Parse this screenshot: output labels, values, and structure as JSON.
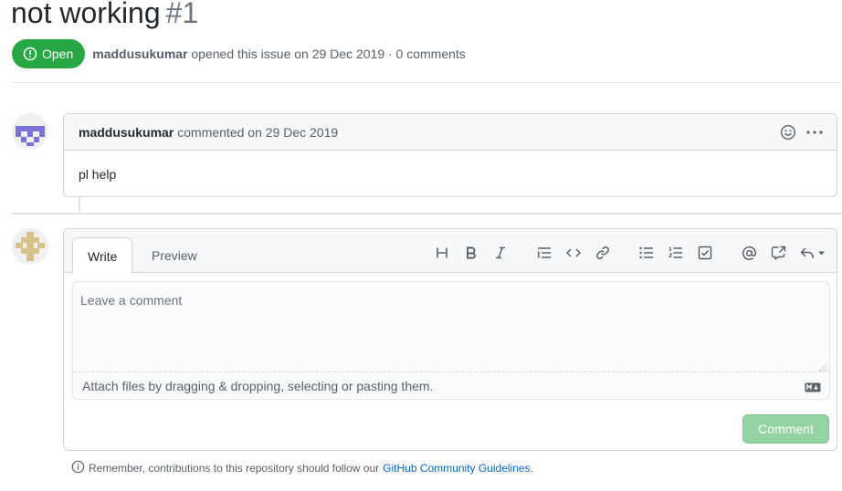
{
  "issue": {
    "title": "not working",
    "number": "#1",
    "state_label": "Open",
    "author": "maddusukumar",
    "meta_suffix": "opened this issue on 29 Dec 2019 · 0 comments"
  },
  "comment": {
    "author": "maddusukumar",
    "when": "commented on 29 Dec 2019",
    "body": "pl help"
  },
  "editor": {
    "tabs": [
      "Write",
      "Preview"
    ],
    "toolbar_icons": [
      "heading-icon",
      "bold-icon",
      "italic-icon",
      "quote-icon",
      "code-icon",
      "link-icon",
      "bulleted-list-icon",
      "numbered-list-icon",
      "task-list-icon",
      "mention-icon",
      "cross-reference-icon",
      "saved-replies-icon"
    ],
    "placeholder": "Leave a comment",
    "attach_hint": "Attach files by dragging & dropping, selecting or pasting them.",
    "submit_label": "Comment"
  },
  "footer": {
    "note": "Remember, contributions to this repository should follow our",
    "link_text": "GitHub Community Guidelines",
    "trailing": "."
  },
  "colors": {
    "open_green": "#28a745",
    "disabled_button": "#94d3a2",
    "link_blue": "#0366d6",
    "avatar_1": "#7a72d6",
    "avatar_2": "#d6c38a"
  }
}
